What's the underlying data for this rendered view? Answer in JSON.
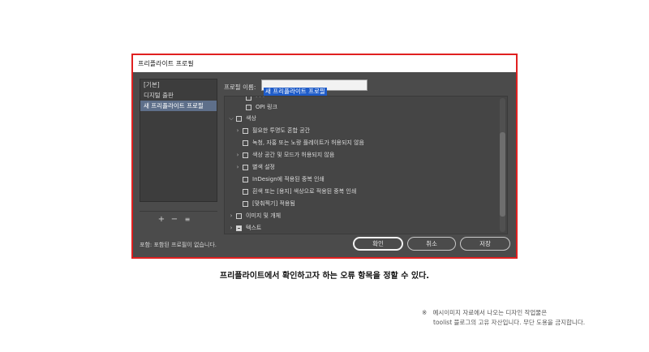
{
  "dialog": {
    "title": "프리플라이트 프로필",
    "presets": [
      "[기본]",
      "디지털 출판",
      "새 프리플라이트 프로필"
    ],
    "selected_index": 2,
    "controls": {
      "add": "+",
      "remove": "−",
      "menu": "≡"
    },
    "profile_name_label": "프로필 이름:",
    "profile_name_value": "새 프리플라이트 프로필",
    "tree": [
      {
        "label": "OPI 링크",
        "level": 2,
        "expandable": false,
        "checkbox": "empty"
      },
      {
        "label": "색상",
        "level": 0,
        "expandable": true,
        "expanded": true,
        "checkbox": "empty"
      },
      {
        "label": "필요한 투명도 혼합 공간",
        "level": 1,
        "expandable": true,
        "checkbox": "empty"
      },
      {
        "label": "녹청, 자홍 또는 노랑 플레이트가 허용되지 않음",
        "level": 1,
        "expandable": false,
        "checkbox": "empty"
      },
      {
        "label": "색상 공간 및 모드가 허용되지 않음",
        "level": 1,
        "expandable": true,
        "checkbox": "empty"
      },
      {
        "label": "별색 설정",
        "level": 1,
        "expandable": true,
        "checkbox": "empty"
      },
      {
        "label": "InDesign에 적용된 중복 인쇄",
        "level": 1,
        "expandable": false,
        "checkbox": "empty"
      },
      {
        "label": "흰색 또는 [용지] 색상으로 적용된 중복 인쇄",
        "level": 1,
        "expandable": false,
        "checkbox": "empty"
      },
      {
        "label": "[맞춰찍기] 적용됨",
        "level": 1,
        "expandable": false,
        "checkbox": "empty"
      },
      {
        "label": "이미지 및 개체",
        "level": 0,
        "expandable": true,
        "checkbox": "empty"
      },
      {
        "label": "텍스트",
        "level": 0,
        "expandable": true,
        "checkbox": "partial"
      }
    ],
    "footer_text": "포함: 포함된 프로필이 없습니다.",
    "buttons": {
      "ok": "확인",
      "cancel": "취소",
      "save": "저장"
    }
  },
  "caption": "프리플라이트에서 확인하고자 하는 오류 항목을 정할 수 있다.",
  "note": {
    "mark": "※",
    "line1": "예시이미지 자료에서 나오는 디자인 작업물은",
    "line2": "toolist 블로그의 고유 자산입니다. 무단 도용을 금지합니다."
  },
  "colors": {
    "frame_border": "#e02020",
    "selection": "#1f5cc9",
    "dialog_bg": "#4b4b4b"
  }
}
